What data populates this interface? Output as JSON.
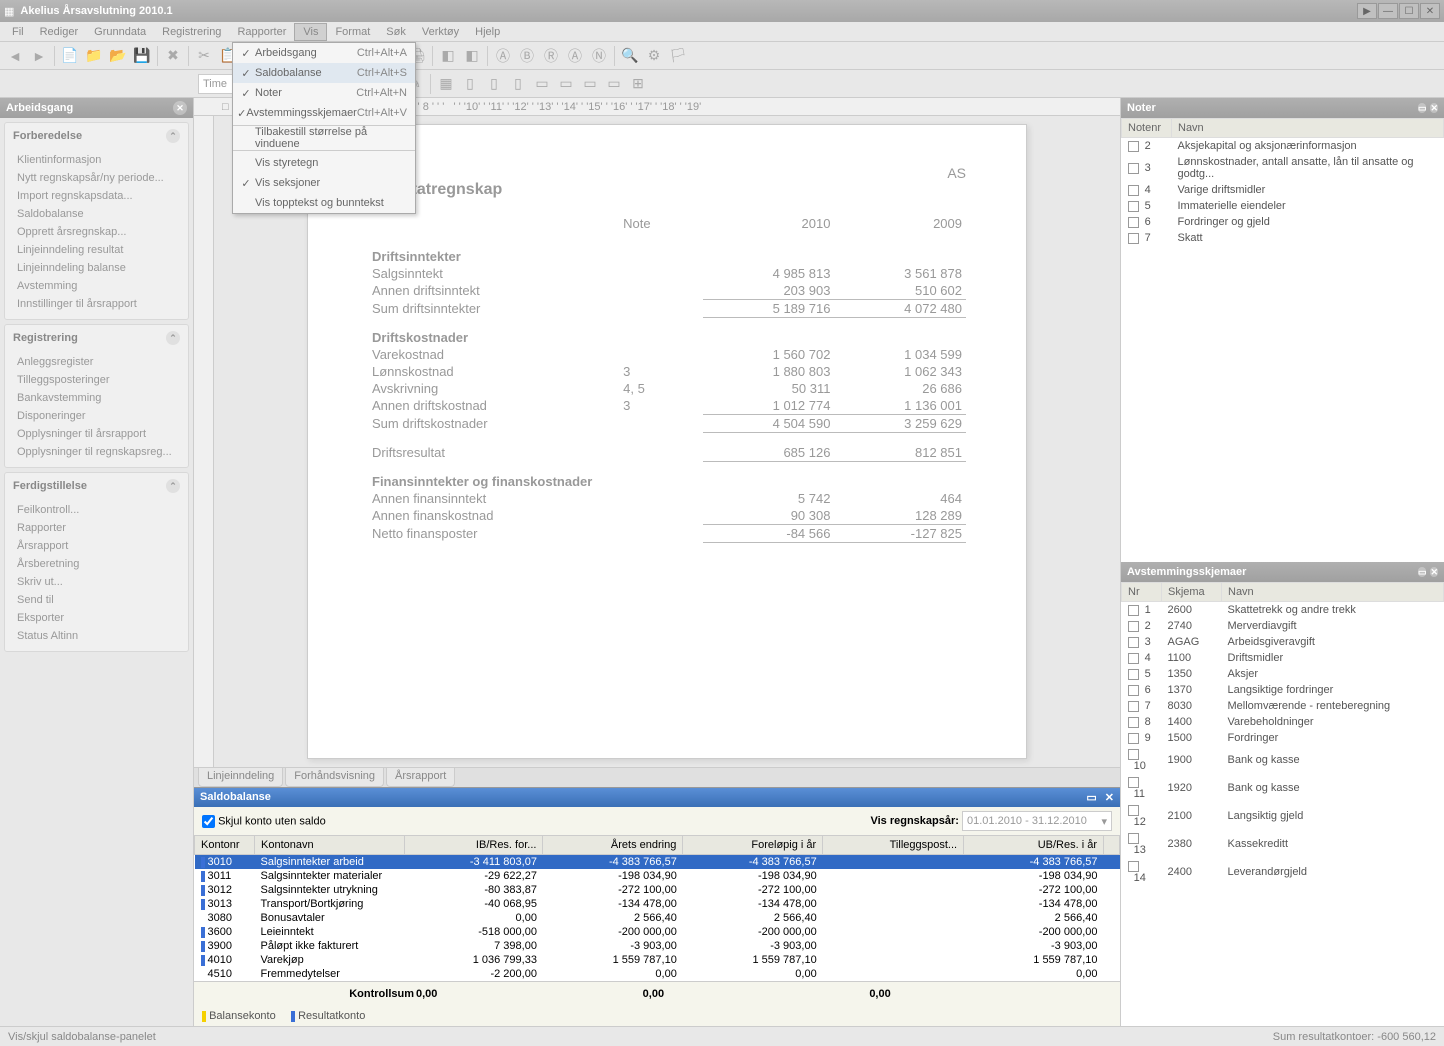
{
  "window": {
    "title": "Akelius Årsavslutning 2010.1"
  },
  "menubar": [
    "Fil",
    "Rediger",
    "Grunndata",
    "Registrering",
    "Rapporter",
    "Vis",
    "Format",
    "Søk",
    "Verktøy",
    "Hjelp"
  ],
  "vis_menu": [
    {
      "label": "Arbeidsgang",
      "shortcut": "Ctrl+Alt+A",
      "checked": true
    },
    {
      "label": "Saldobalanse",
      "shortcut": "Ctrl+Alt+S",
      "checked": true,
      "hi": true
    },
    {
      "label": "Noter",
      "shortcut": "Ctrl+Alt+N",
      "checked": true
    },
    {
      "label": "Avstemmingsskjemaer",
      "shortcut": "Ctrl+Alt+V",
      "checked": true
    },
    {
      "sep": true
    },
    {
      "label": "Tilbakestill størrelse på vinduene"
    },
    {
      "sep": true
    },
    {
      "label": "Vis styretegn"
    },
    {
      "label": "Vis seksjoner",
      "checked": true
    },
    {
      "label": "Vis topptekst og bunntekst"
    }
  ],
  "toolbar2": {
    "font": "Time",
    "align": "left"
  },
  "sidebar": {
    "title": "Arbeidsgang",
    "sections": [
      {
        "title": "Forberedelse",
        "items": [
          "Klientinformasjon",
          "Nytt regnskapsår/ny periode...",
          "Import regnskapsdata...",
          "Saldobalanse",
          "Opprett årsregnskap...",
          "Linjeinndeling resultat",
          "Linjeinndeling balanse",
          "Avstemming",
          "Innstillinger til årsrapport"
        ]
      },
      {
        "title": "Registrering",
        "items": [
          "Anleggsregister",
          "Tilleggsposteringer",
          "Bankavstemming",
          "Disponeringer",
          "Opplysninger til årsrapport",
          "Opplysninger til regnskapsreg..."
        ]
      },
      {
        "title": "Ferdigstillelse",
        "items": [
          "Feilkontroll...",
          "Rapporter",
          "Årsrapport",
          "Årsberetning",
          "Skriv ut...",
          "Send til",
          "Eksporter",
          "Status Altinn"
        ]
      }
    ]
  },
  "doc": {
    "company_suffix": "AS",
    "heading": "Resultatregnskap",
    "cols": [
      "Note",
      "2010",
      "2009"
    ],
    "sec1": "Driftsinntekter",
    "r1": {
      "l": "Salgsinntekt",
      "a": "4 985 813",
      "b": "3 561 878"
    },
    "r2": {
      "l": "Annen driftsinntekt",
      "a": "203 903",
      "b": "510 602"
    },
    "r3": {
      "l": "Sum driftsinntekter",
      "a": "5 189 716",
      "b": "4 072 480"
    },
    "sec2": "Driftskostnader",
    "r4": {
      "l": "Varekostnad",
      "a": "1 560 702",
      "b": "1 034 599"
    },
    "r5": {
      "l": "Lønnskostnad",
      "n": "3",
      "a": "1 880 803",
      "b": "1 062 343"
    },
    "r6": {
      "l": "Avskrivning",
      "n": "4, 5",
      "a": "50 311",
      "b": "26 686"
    },
    "r7": {
      "l": "Annen driftskostnad",
      "n": "3",
      "a": "1 012 774",
      "b": "1 136 001"
    },
    "r8": {
      "l": "Sum driftskostnader",
      "a": "4 504 590",
      "b": "3 259 629"
    },
    "r9": {
      "l": "Driftsresultat",
      "a": "685 126",
      "b": "812 851"
    },
    "sec3": "Finansinntekter og finanskostnader",
    "r10": {
      "l": "Annen finansinntekt",
      "a": "5 742",
      "b": "464"
    },
    "r11": {
      "l": "Annen finanskostnad",
      "a": "90 308",
      "b": "128 289"
    },
    "r12": {
      "l": "Netto finansposter",
      "a": "-84 566",
      "b": "-127 825"
    }
  },
  "center_tabs": [
    "Linjeinndeling",
    "Forhåndsvisning",
    "Årsrapport"
  ],
  "saldo": {
    "title": "Saldobalanse",
    "hide_label": "Skjul konto uten saldo",
    "period_label": "Vis regnskapsår:",
    "period": "01.01.2010 - 31.12.2010",
    "cols": [
      "Kontonr",
      "Kontonavn",
      "IB/Res. for...",
      "Årets endring",
      "Foreløpig i år",
      "Tilleggspost...",
      "UB/Res. i år"
    ],
    "rows": [
      {
        "m": "b",
        "k": "3010",
        "n": "Salgsinntekter arbeid",
        "c": [
          "-3 411 803,07",
          "-4 383 766,57",
          "-4 383 766,57",
          "",
          "-4 383 766,57"
        ],
        "sel": true
      },
      {
        "m": "b",
        "k": "3011",
        "n": "Salgsinntekter materialer",
        "c": [
          "-29 622,27",
          "-198 034,90",
          "-198 034,90",
          "",
          "-198 034,90"
        ]
      },
      {
        "m": "b",
        "k": "3012",
        "n": "Salgsinntekter utrykning",
        "c": [
          "-80 383,87",
          "-272 100,00",
          "-272 100,00",
          "",
          "-272 100,00"
        ]
      },
      {
        "m": "b",
        "k": "3013",
        "n": "Transport/Bortkjøring",
        "c": [
          "-40 068,95",
          "-134 478,00",
          "-134 478,00",
          "",
          "-134 478,00"
        ]
      },
      {
        "m": "",
        "k": "3080",
        "n": "Bonusavtaler",
        "c": [
          "0,00",
          "2 566,40",
          "2 566,40",
          "",
          "2 566,40"
        ]
      },
      {
        "m": "b",
        "k": "3600",
        "n": "Leieinntekt",
        "c": [
          "-518 000,00",
          "-200 000,00",
          "-200 000,00",
          "",
          "-200 000,00"
        ]
      },
      {
        "m": "b",
        "k": "3900",
        "n": "Påløpt ikke fakturert",
        "c": [
          "7 398,00",
          "-3 903,00",
          "-3 903,00",
          "",
          "-3 903,00"
        ]
      },
      {
        "m": "b",
        "k": "4010",
        "n": "Varekjøp",
        "c": [
          "1 036 799,33",
          "1 559 787,10",
          "1 559 787,10",
          "",
          "1 559 787,10"
        ]
      },
      {
        "m": "",
        "k": "4510",
        "n": "Fremmedytelser",
        "c": [
          "-2 200,00",
          "0,00",
          "0,00",
          "",
          "0,00"
        ]
      }
    ],
    "sum_label": "Kontrollsum",
    "sums": [
      "0,00",
      "",
      "0,00",
      "",
      "0,00"
    ],
    "legend": [
      "Balansekonto",
      "Resultatkonto"
    ]
  },
  "noter": {
    "title": "Noter",
    "cols": [
      "Notenr",
      "Navn"
    ],
    "rows": [
      {
        "n": "2",
        "t": "Aksjekapital og aksjonærinformasjon"
      },
      {
        "n": "3",
        "t": "Lønnskostnader, antall ansatte, lån til ansatte og godtg..."
      },
      {
        "n": "4",
        "t": "Varige driftsmidler"
      },
      {
        "n": "5",
        "t": "Immaterielle eiendeler"
      },
      {
        "n": "6",
        "t": "Fordringer og gjeld"
      },
      {
        "n": "7",
        "t": "Skatt"
      }
    ]
  },
  "avstemming": {
    "title": "Avstemmingsskjemaer",
    "cols": [
      "Nr",
      "Skjema",
      "Navn"
    ],
    "rows": [
      {
        "n": "1",
        "s": "2600",
        "t": "Skattetrekk og andre trekk"
      },
      {
        "n": "2",
        "s": "2740",
        "t": "Merverdiavgift"
      },
      {
        "n": "3",
        "s": "AGAG",
        "t": "Arbeidsgiveravgift"
      },
      {
        "n": "4",
        "s": "1100",
        "t": "Driftsmidler"
      },
      {
        "n": "5",
        "s": "1350",
        "t": "Aksjer"
      },
      {
        "n": "6",
        "s": "1370",
        "t": "Langsiktige fordringer"
      },
      {
        "n": "7",
        "s": "8030",
        "t": "Mellomværende - renteberegning"
      },
      {
        "n": "8",
        "s": "1400",
        "t": "Varebeholdninger"
      },
      {
        "n": "9",
        "s": "1500",
        "t": "Fordringer"
      },
      {
        "n": "10",
        "s": "1900",
        "t": "Bank og kasse"
      },
      {
        "n": "11",
        "s": "1920",
        "t": "Bank og kasse"
      },
      {
        "n": "12",
        "s": "2100",
        "t": "Langsiktig gjeld"
      },
      {
        "n": "13",
        "s": "2380",
        "t": "Kassekreditt"
      },
      {
        "n": "14",
        "s": "2400",
        "t": "Leverandørgjeld"
      }
    ]
  },
  "status": {
    "left": "Vis/skjul saldobalanse-panelet",
    "right": "Sum resultatkontoer: -600 560,12"
  }
}
